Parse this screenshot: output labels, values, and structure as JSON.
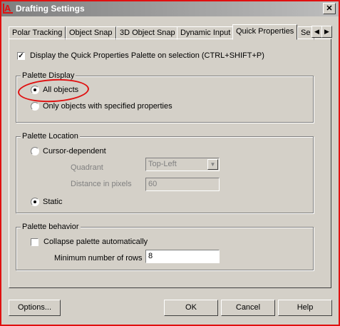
{
  "window": {
    "title": "Drafting Settings",
    "close_label": "✕"
  },
  "tabs": [
    {
      "label": "Polar Tracking"
    },
    {
      "label": "Object Snap"
    },
    {
      "label": "3D Object Snap"
    },
    {
      "label": "Dynamic Input"
    },
    {
      "label": "Quick Properties"
    },
    {
      "label": "Se"
    }
  ],
  "scroll": {
    "left": "◀",
    "right": "▶"
  },
  "display_palette": {
    "label": "Display the Quick Properties Palette on selection (CTRL+SHIFT+P)",
    "checked": true
  },
  "palette_display": {
    "title": "Palette Display",
    "all_objects": "All objects",
    "only_specified": "Only objects with specified properties",
    "selected": "all_objects"
  },
  "palette_location": {
    "title": "Palette Location",
    "cursor_dependent": "Cursor-dependent",
    "quadrant_label": "Quadrant",
    "quadrant_value": "Top-Left",
    "distance_label": "Distance in pixels",
    "distance_value": "60",
    "static": "Static",
    "selected": "static"
  },
  "palette_behavior": {
    "title": "Palette behavior",
    "collapse_label": "Collapse palette automatically",
    "collapse_checked": false,
    "min_rows_label": "Minimum number of rows",
    "min_rows_value": "8"
  },
  "buttons": {
    "options": "Options...",
    "ok": "OK",
    "cancel": "Cancel",
    "help": "Help"
  },
  "colors": {
    "annotation": "#e01010",
    "dialog_bg": "#d4d0c8"
  }
}
